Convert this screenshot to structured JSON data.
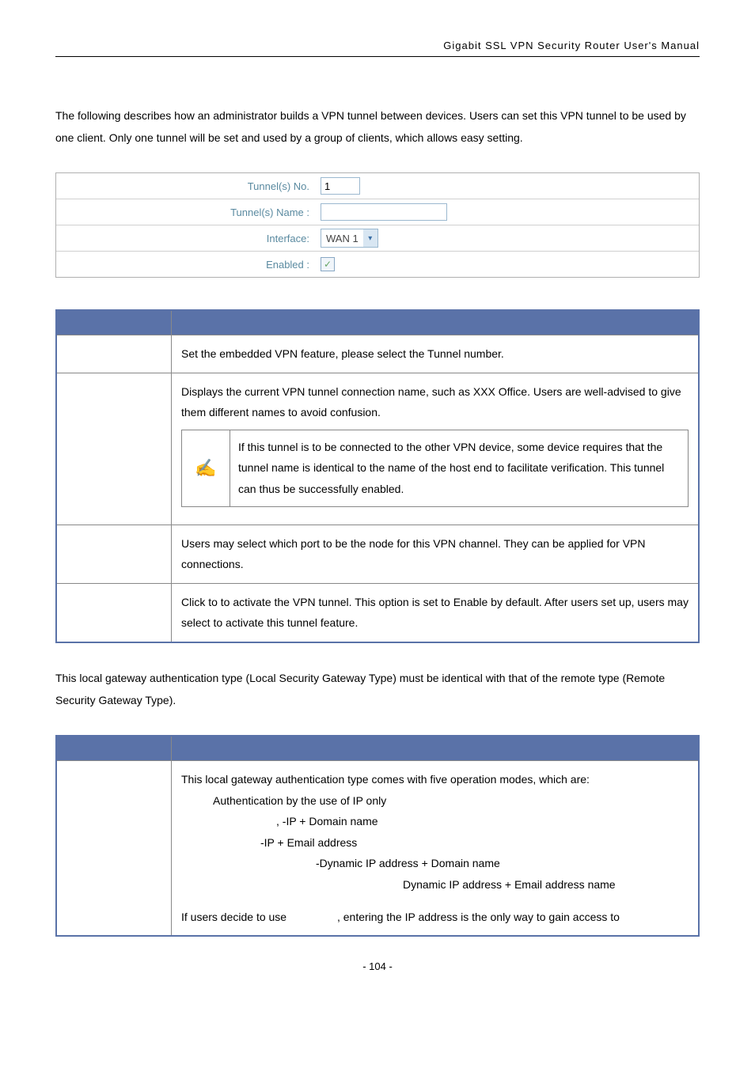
{
  "header": {
    "title": "Gigabit SSL VPN Security Router User's Manual"
  },
  "intro": {
    "text": "The following describes how an administrator builds a VPN tunnel between devices. Users can set this VPN tunnel to be used by one client. Only one tunnel will be set and used by a group of clients, which allows easy setting."
  },
  "form": {
    "tunnel_no_label": "Tunnel(s) No.",
    "tunnel_no_value": "1",
    "tunnel_name_label": "Tunnel(s) Name :",
    "tunnel_name_value": "",
    "interface_label": "Interface:",
    "interface_value": "WAN 1",
    "enabled_label": "Enabled :",
    "enabled_check": "✓"
  },
  "table1": {
    "row1": "Set the embedded VPN feature, please select the Tunnel number.",
    "row2_a": "Displays the current VPN tunnel connection name, such as XXX Office. Users are well-advised to give them different names to avoid confusion.",
    "row2_note": "If this tunnel is to be connected to the other VPN device, some device requires that the tunnel name is identical to the name of the host end to facilitate verification. This tunnel can thus be successfully enabled.",
    "row3": "Users may select which port to be the node for this VPN channel. They can be applied for VPN connections.",
    "row4_a": "Click to ",
    "row4_b": " to activate the VPN tunnel. This option is set to Enable by default. After users set up, users may select to activate this tunnel feature."
  },
  "mid_para": "This local gateway authentication type (Local Security Gateway Type) must be identical with that of the remote type (Remote Security Gateway Type).",
  "table2": {
    "intro": "This local gateway authentication type comes with five operation modes, which are:",
    "m1": "Authentication by the use of IP only",
    "m2": ", -IP + Domain name",
    "m3": "-IP + Email address",
    "m4": "-Dynamic IP address + Domain name",
    "m5": "Dynamic IP address + Email address name",
    "last_a": "If users decide to use ",
    "last_b": ", entering the IP address is the only way to gain access to"
  },
  "footer": {
    "page": "- 104 -"
  }
}
